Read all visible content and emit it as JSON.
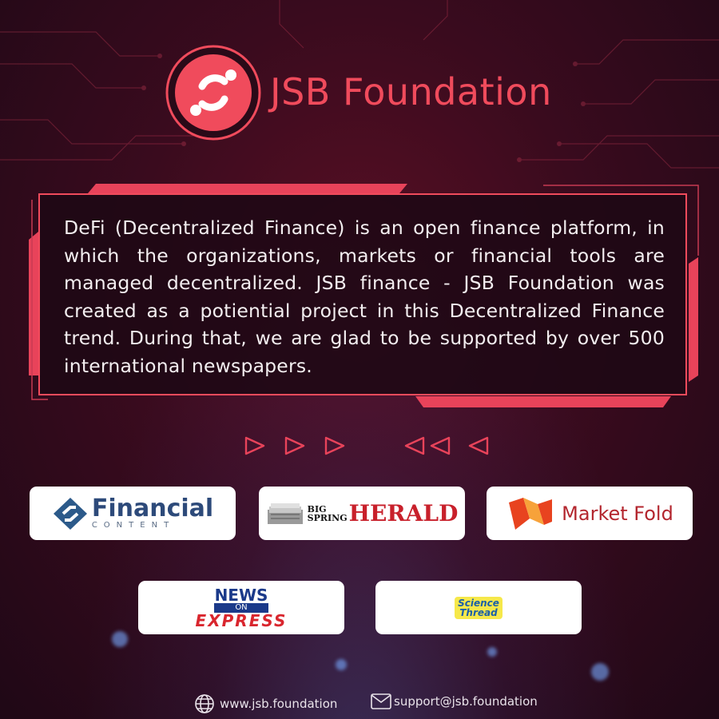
{
  "brand": {
    "name": "JSB Foundation",
    "accent_color": "#f04b5c"
  },
  "description": "DeFi (Decentralized Finance) is an open finance platform, in which the organizations, markets or financial tools are managed decentralized. JSB finance - JSB Foundation was created as a potiential project in this Decentralized Finance trend. During that, we are glad to be supported by over 500 international newspapers.",
  "partners": {
    "financial_content": {
      "main": "Financial",
      "sub": "CONTENT"
    },
    "big_spring_herald": {
      "line1": "BIG",
      "line2": "SPRING",
      "main": "HERALD"
    },
    "market_fold": {
      "main": "Market Fold"
    },
    "news_on_express": {
      "top": "NEWS",
      "middle": "ON",
      "bottom": "EXPRESS"
    },
    "science_thread": {
      "line1": "Science",
      "line2": "Thread"
    }
  },
  "footer": {
    "website": "www.jsb.foundation",
    "email": "support@jsb.foundation",
    "website_icon": "globe-icon",
    "email_icon": "mail-icon"
  }
}
